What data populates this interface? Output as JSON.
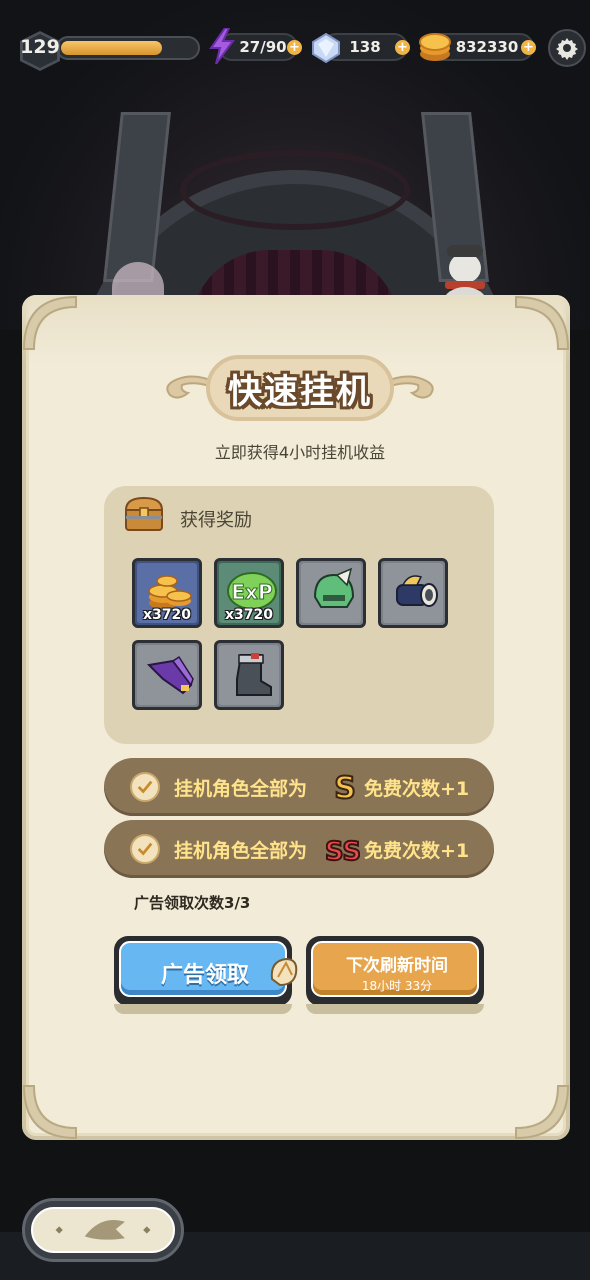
{
  "hud": {
    "level": "129",
    "xp_fraction": 0.75,
    "energy": "27/90",
    "gems": "138",
    "gold": "832330",
    "plus_label": "+"
  },
  "dialog": {
    "title": "快速挂机",
    "subtitle": "立即获得4小时挂机收益",
    "rewards_label": "获得奖励",
    "rewards": [
      {
        "icon": "gold-coins-icon",
        "qty": "x3720"
      },
      {
        "icon": "exp-icon",
        "qty": "x3720"
      },
      {
        "icon": "green-helmet-icon",
        "qty": ""
      },
      {
        "icon": "gauntlet-icon",
        "qty": ""
      },
      {
        "icon": "purple-cloak-icon",
        "qty": ""
      },
      {
        "icon": "boots-icon",
        "qty": ""
      }
    ],
    "conditions": [
      {
        "prefix": "挂机角色全部为",
        "rank": "S",
        "suffix": "免费次数+1"
      },
      {
        "prefix": "挂机角色全部为",
        "rank": "SS",
        "suffix": "免费次数+1"
      }
    ],
    "ad_count": "广告领取次数3/3",
    "ad_button": "广告领取",
    "refresh_button": "下次刷新时间",
    "refresh_time": "18小时 33分"
  },
  "colors": {
    "panel": "#f1ebd8",
    "condition_bar": "#8a7456",
    "ad_button": "#67b8f2",
    "refresh_button": "#e7a64e",
    "gold_text": "#ffe38a"
  }
}
